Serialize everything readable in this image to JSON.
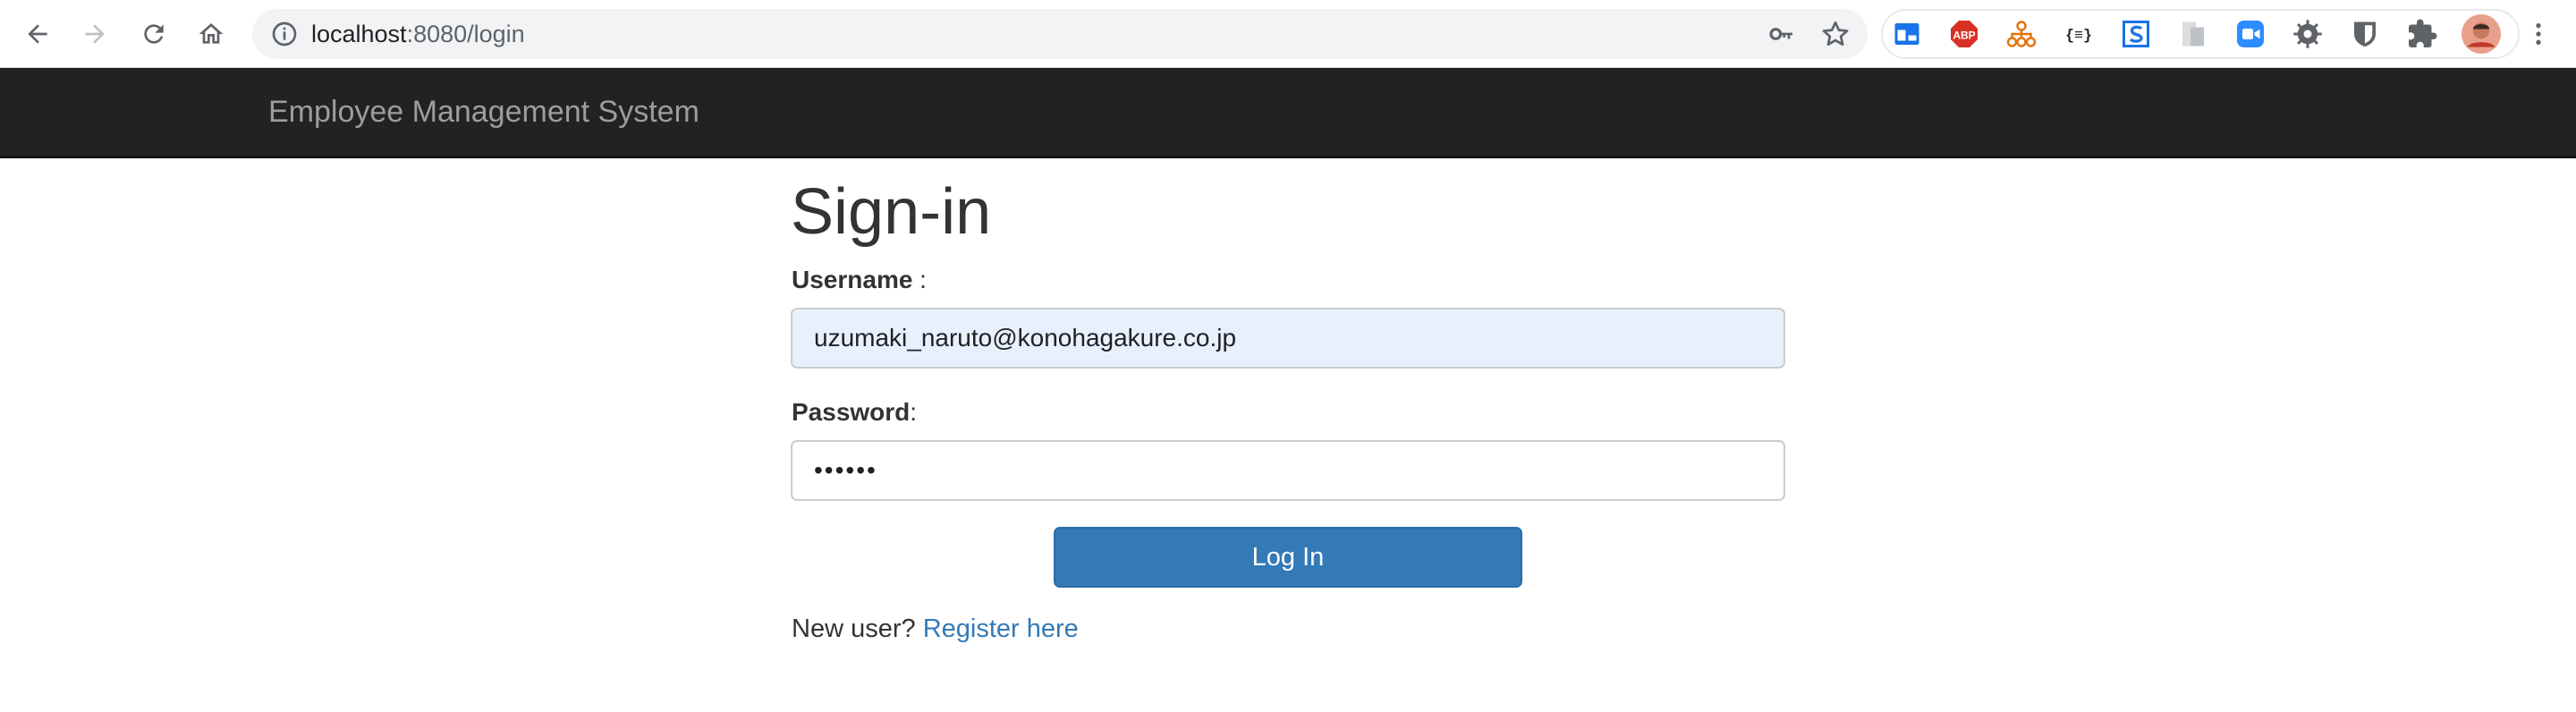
{
  "browser": {
    "url_host": "localhost",
    "url_path": ":8080/login",
    "extensions": [
      "tab-manager-icon",
      "adblock-plus-icon",
      "sitemap-icon",
      "json-viewer-icon",
      "s-extension-icon",
      "clipboard-icon",
      "zoom-icon",
      "settings-gear-icon",
      "bitwarden-icon",
      "puzzle-icon"
    ],
    "extension_labels": {
      "abp": "ABP",
      "json": "{≡}"
    }
  },
  "navbar": {
    "brand": "Employee Management System"
  },
  "login": {
    "title": "Sign-in",
    "username_label": "Username",
    "username_colon": " :",
    "username_value": "uzumaki_naruto@konohagakure.co.jp",
    "password_label": "Password",
    "password_colon": ":",
    "password_value": "••••••",
    "submit_label": "Log In",
    "new_user_text": "New user?",
    "register_link": "Register here"
  },
  "colors": {
    "navbar_bg": "#222222",
    "brand_text": "#9d9d9d",
    "primary": "#337ab7",
    "autofill_bg": "#e8f0fe"
  }
}
